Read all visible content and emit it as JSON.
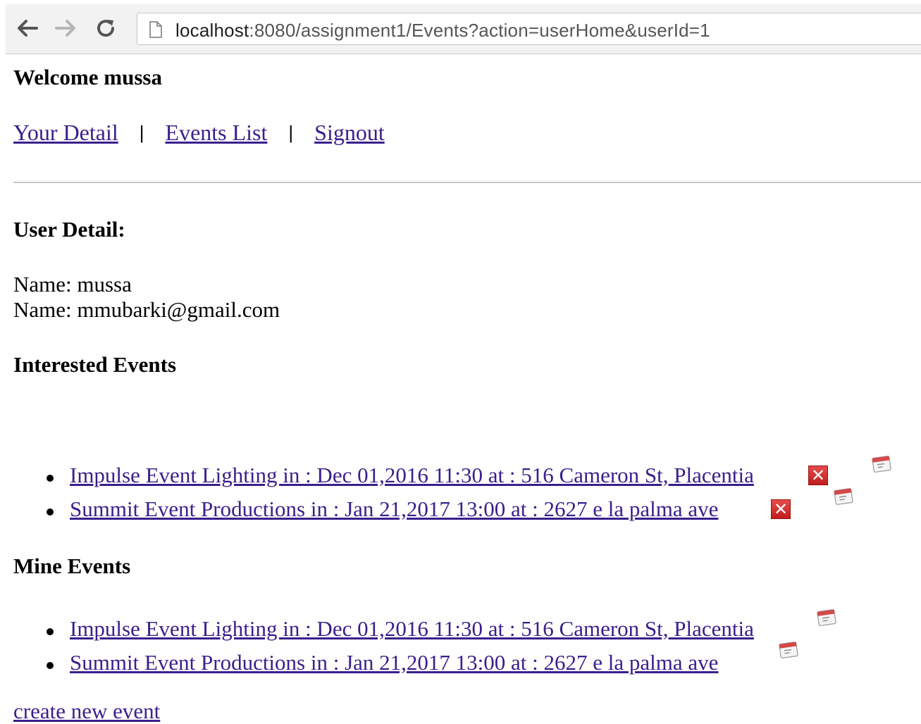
{
  "browser": {
    "url_host": "localhost",
    "url_rest": ":8080/assignment1/Events?action=userHome&userId=1"
  },
  "header": {
    "welcome": "Welcome mussa"
  },
  "nav": {
    "your_detail": "Your Detail",
    "separator": "|",
    "events_list": "Events List",
    "signout": "Signout"
  },
  "user_detail": {
    "heading": "User Detail:",
    "name_line": "Name: mussa",
    "email_line": "Name: mmubarki@gmail.com"
  },
  "interested": {
    "heading": "Interested Events",
    "items": [
      {
        "label": "Impulse Event Lighting in : Dec 01,2016 11:30 at : 516 Cameron St, Placentia ",
        "delete_glyph": "✕",
        "calendar_icon": "calendar-icon"
      },
      {
        "label": "Summit Event Productions in : Jan 21,2017 13:00 at : 2627 e la palma ave ",
        "delete_glyph": "✕",
        "calendar_icon": "calendar-icon"
      }
    ]
  },
  "mine": {
    "heading": "Mine Events",
    "items": [
      {
        "label": "Impulse Event Lighting in : Dec 01,2016 11:30 at : 516 Cameron St, Placentia ",
        "calendar_icon": "calendar-icon"
      },
      {
        "label": "Summit Event Productions in : Jan 21,2017 13:00 at : 2627 e la palma ave ",
        "calendar_icon": "calendar-icon"
      }
    ]
  },
  "footer": {
    "create_link": "create new event "
  },
  "colors": {
    "link": "#3a1f8c",
    "delete_red": "#d42b2b",
    "rule": "#c6c6c6"
  }
}
